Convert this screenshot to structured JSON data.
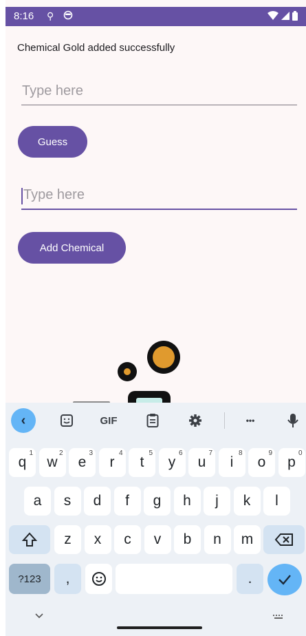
{
  "status": {
    "time": "8:16",
    "icons": [
      "location-icon",
      "face-icon",
      "wifi-icon",
      "signal-icon",
      "battery-icon"
    ]
  },
  "message": "Chemical Gold added successfully",
  "field1": {
    "placeholder": "Type here"
  },
  "guess_button": "Guess",
  "field2": {
    "placeholder": "Type here"
  },
  "add_button": "Add Chemical",
  "keyboard": {
    "toolbar": {
      "gif": "GIF",
      "more": "•••"
    },
    "row1": [
      {
        "k": "q",
        "h": "1"
      },
      {
        "k": "w",
        "h": "2"
      },
      {
        "k": "e",
        "h": "3"
      },
      {
        "k": "r",
        "h": "4"
      },
      {
        "k": "t",
        "h": "5"
      },
      {
        "k": "y",
        "h": "6"
      },
      {
        "k": "u",
        "h": "7"
      },
      {
        "k": "i",
        "h": "8"
      },
      {
        "k": "o",
        "h": "9"
      },
      {
        "k": "p",
        "h": "0"
      }
    ],
    "row2": [
      "a",
      "s",
      "d",
      "f",
      "g",
      "h",
      "j",
      "k",
      "l"
    ],
    "row3": [
      "z",
      "x",
      "c",
      "v",
      "b",
      "n",
      "m"
    ],
    "symbols": "?123",
    "comma": ",",
    "period": "."
  },
  "colors": {
    "primary": "#6651a4",
    "accent_blue": "#64b5f6",
    "background": "#fdf7f7"
  }
}
